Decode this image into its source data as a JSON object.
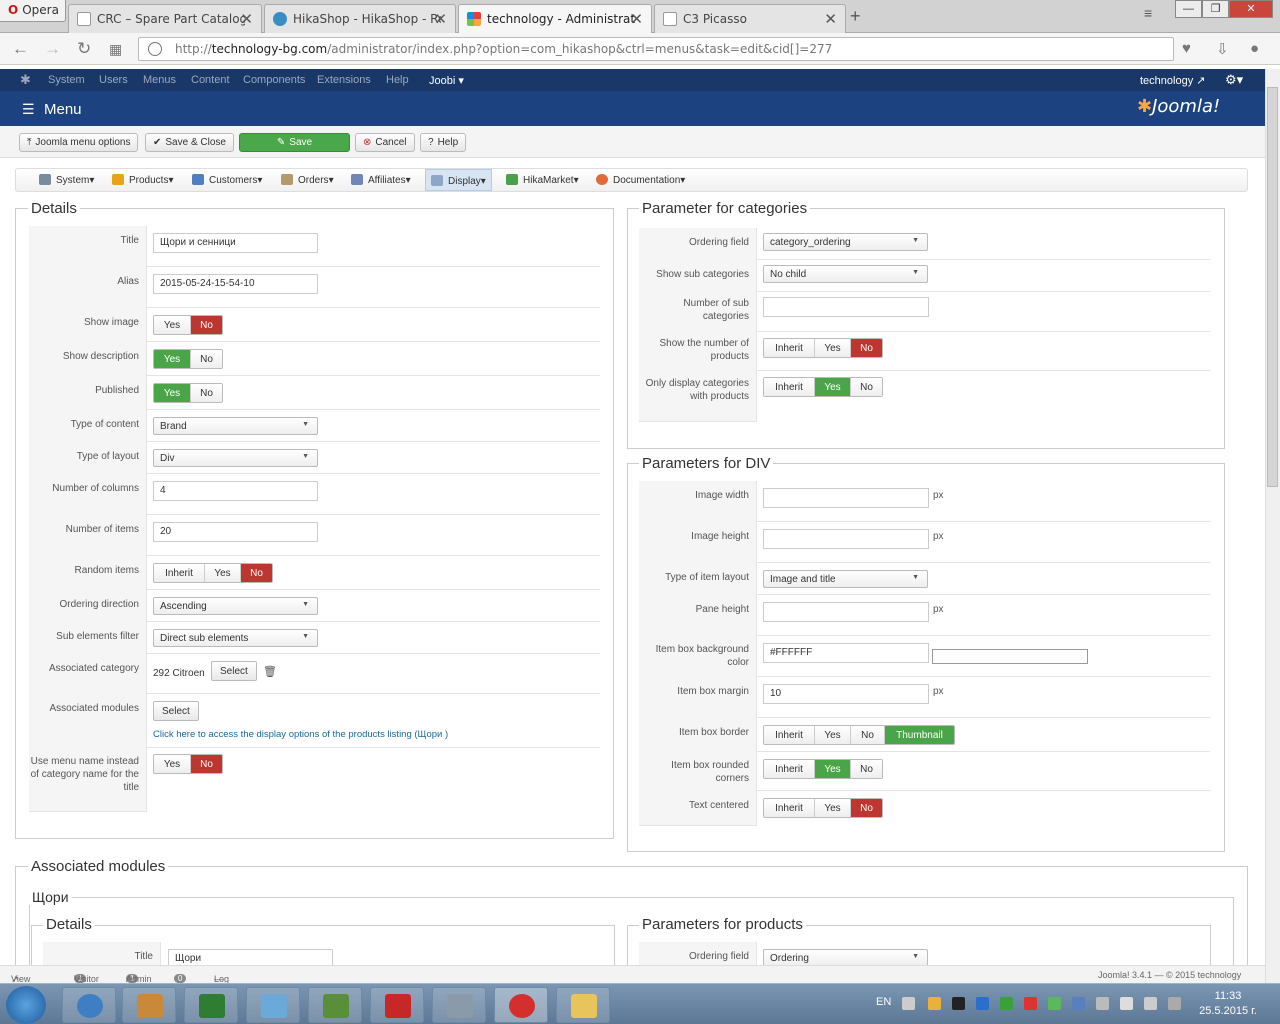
{
  "browser": {
    "opera_label": "Opera",
    "tabs": [
      {
        "title": "CRC – Spare Part Catalogu",
        "active": false
      },
      {
        "title": "HikaShop - HikaShop - Re",
        "active": false
      },
      {
        "title": "technology - Administratio",
        "active": true
      },
      {
        "title": "C3 Picasso",
        "active": false
      }
    ],
    "url_scheme": "http://",
    "url_host": "technology-bg.com",
    "url_path": "/administrator/index.php?option=com_hikashop&ctrl=menus&task=edit&cid[]=277"
  },
  "joomla_menu": {
    "items": [
      "System",
      "Users",
      "Menus",
      "Content",
      "Components",
      "Extensions",
      "Help"
    ],
    "joobi": "Joobi",
    "user": "technology",
    "page_title": "Menu",
    "logo_text": "Joomla!"
  },
  "toolbar": {
    "menu_options": "Joomla menu options",
    "save_close": "Save & Close",
    "save": "Save",
    "cancel": "Cancel",
    "help": "Help"
  },
  "hikashop_menu": {
    "items": [
      "System",
      "Products",
      "Customers",
      "Orders",
      "Affiliates",
      "Display",
      "HikaMarket",
      "Documentation"
    ],
    "active": "Display"
  },
  "details": {
    "legend": "Details",
    "title_label": "Title",
    "title_value": "Щори и сенници",
    "alias_label": "Alias",
    "alias_value": "2015-05-24-15-54-10",
    "show_image_label": "Show image",
    "show_description_label": "Show description",
    "published_label": "Published",
    "type_content_label": "Type of content",
    "type_content_value": "Brand",
    "type_layout_label": "Type of layout",
    "type_layout_value": "Div",
    "num_columns_label": "Number of columns",
    "num_columns_value": "4",
    "num_items_label": "Number of items",
    "num_items_value": "20",
    "random_items_label": "Random items",
    "ordering_dir_label": "Ordering direction",
    "ordering_dir_value": "Ascending",
    "sub_filter_label": "Sub elements filter",
    "sub_filter_value": "Direct sub elements",
    "assoc_category_label": "Associated category",
    "assoc_category_value": "292 Citroen",
    "select_label": "Select",
    "assoc_modules_label": "Associated modules",
    "access_link": "Click here to access the display options of the products listing (Щори )",
    "use_menu_name_label": "Use menu name instead of category name for the title",
    "yes": "Yes",
    "no": "No",
    "inherit": "Inherit"
  },
  "param_categories": {
    "legend": "Parameter for categories",
    "ordering_field_label": "Ordering field",
    "ordering_field_value": "category_ordering",
    "show_sub_label": "Show sub categories",
    "show_sub_value": "No child",
    "number_sub_label": "Number of sub categories",
    "show_number_label": "Show the number of products",
    "only_display_label": "Only display categories with products"
  },
  "param_div": {
    "legend": "Parameters for DIV",
    "image_width_label": "Image width",
    "image_height_label": "Image height",
    "item_layout_label": "Type of item layout",
    "item_layout_value": "Image and title",
    "pane_height_label": "Pane height",
    "bg_color_label": "Item box background color",
    "bg_color_value": "#FFFFFF",
    "margin_label": "Item box margin",
    "margin_value": "10",
    "border_label": "Item box border",
    "thumbnail": "Thumbnail",
    "rounded_label": "Item box rounded corners",
    "centered_label": "Text centered",
    "px": "px"
  },
  "assoc_modules_section": {
    "legend": "Associated modules",
    "module_name": "Щори",
    "details_legend": "Details",
    "title_label": "Title",
    "title_value": "Щори",
    "products_legend": "Parameters for products",
    "ordering_field_label": "Ordering field",
    "ordering_field_value": "Ordering"
  },
  "statusbar": {
    "view_site": "View Site",
    "visitor_count": "1",
    "visitor": "Visitor",
    "admin_count": "1",
    "admin": "Admin",
    "messages_count": "0",
    "logout": "Log out",
    "version": "Joomla! 3.4.1 — © 2015 technology"
  },
  "taskbar": {
    "language": "EN",
    "time": "11:33",
    "date": "25.5.2015 г."
  },
  "colors": {
    "joomla_dark": "#1a3867",
    "joomla_header": "#1d4280",
    "active_green": "#49a547",
    "active_red": "#bd362f"
  }
}
